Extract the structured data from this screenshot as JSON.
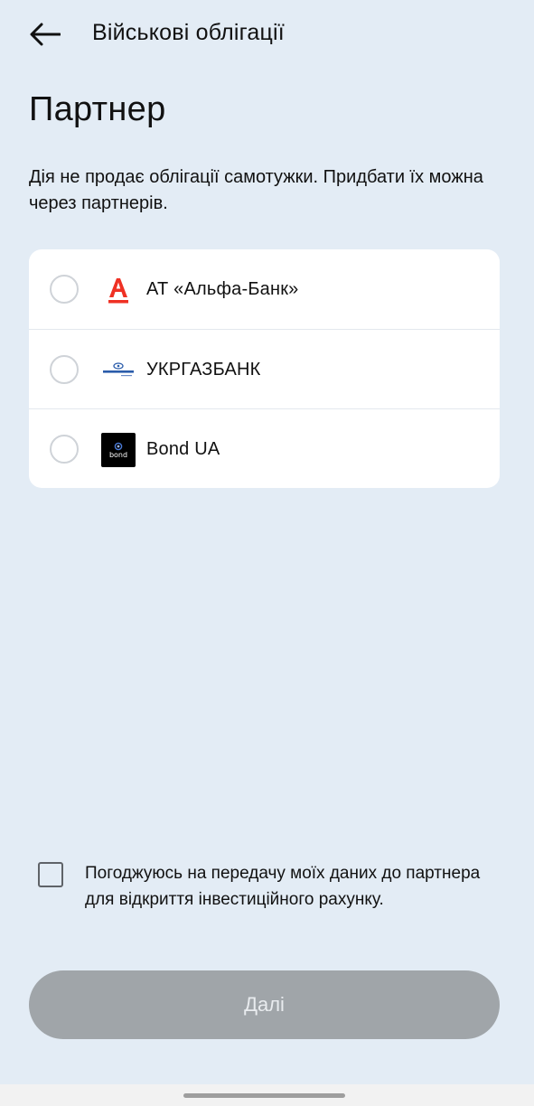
{
  "header": {
    "back_icon": "arrow-left-icon",
    "title": "Військові облігації"
  },
  "page": {
    "title": "Партнер",
    "description": "Дія не продає облігації самотужки. Придбати їх можна через партнерів."
  },
  "partners": [
    {
      "name": "АТ «Альфа-Банк»",
      "logo_icon": "alfa-bank-logo",
      "logo_color": "#ef3124",
      "selected": false
    },
    {
      "name": "УКРГАЗБАНК",
      "logo_icon": "ukrgasbank-logo",
      "logo_color": "#2a5caa",
      "selected": false
    },
    {
      "name": "Bond UA",
      "logo_icon": "bond-ua-logo",
      "logo_text": "bond",
      "logo_color": "#000000",
      "selected": false
    }
  ],
  "consent": {
    "text": "Погоджуюсь на передачу моїх даних до партнера для відкриття інвестиційного рахунку.",
    "checked": false
  },
  "next_button": {
    "label": "Далі",
    "enabled": false
  },
  "colors": {
    "background": "#e3ecf5",
    "card": "#ffffff",
    "button_disabled": "#a0a5a9"
  }
}
